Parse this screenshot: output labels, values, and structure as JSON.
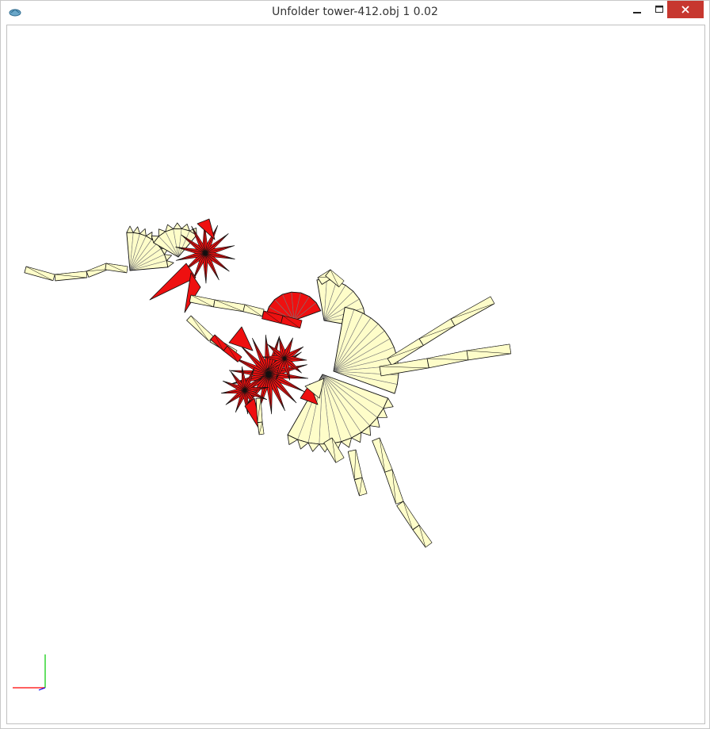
{
  "window": {
    "title": "Unfolder tower-412.obj 1 0.02",
    "controls": [
      "minimize",
      "maximize",
      "close"
    ]
  },
  "icons": {
    "app": "unfolder-app-icon",
    "minimize": "minimize-icon",
    "maximize": "maximize-icon",
    "close": "close-icon"
  },
  "colors": {
    "face_fill": "#fefdc9",
    "highlight_fill": "#ee1010",
    "edge": "#111111",
    "inner_edge": "#777777",
    "close_button": "#c7372f",
    "axis_x": "#ff0000",
    "axis_y": "#00cc00",
    "axis_z": "#0000ff"
  },
  "viewport": {
    "content": "unfolded-mesh-render",
    "axes_gizmo": [
      "x-axis",
      "y-axis",
      "z-axis"
    ]
  }
}
